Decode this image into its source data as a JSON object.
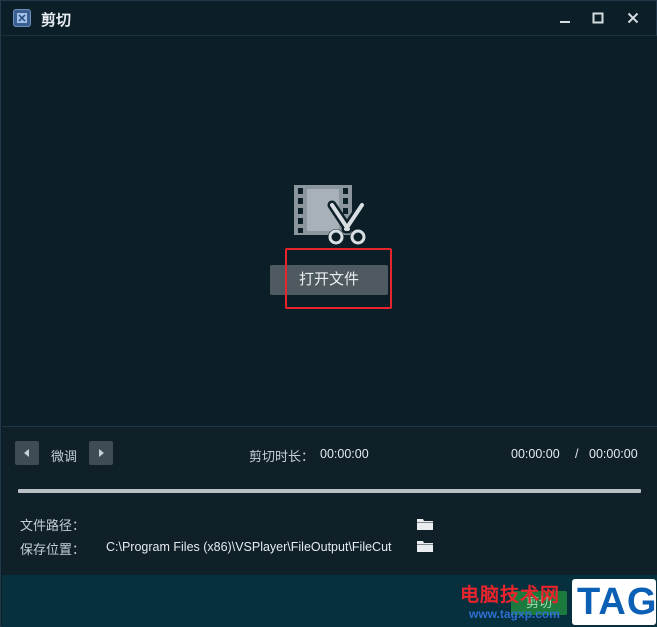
{
  "window": {
    "title": "剪切"
  },
  "titlebar": {
    "minimize": "minimize",
    "maximize": "maximize",
    "close": "close"
  },
  "stage": {
    "open_button_label": "打开文件"
  },
  "controls": {
    "fine_tune_label": "微调",
    "cut_duration_label": "剪切时长：",
    "cut_duration_value": "00:00:00",
    "current_time": "00:00:00",
    "time_separator": "/",
    "total_time": "00:00:00",
    "progress_fraction": 0
  },
  "paths": {
    "file_path_label": "文件路径：",
    "file_path_value": "",
    "save_location_label": "保存位置：",
    "save_location_value": "C:\\Program Files (x86)\\VSPlayer\\FileOutput\\FileCut"
  },
  "footer": {
    "cut_button_label": "剪切"
  },
  "watermark": {
    "site_name": "电脑技术网",
    "site_url": "www.tagxp.com",
    "tag_text": "TAG"
  },
  "colors": {
    "highlight_border": "#e8242c",
    "accent_green": "#1c7a3e",
    "background": "#0c1e27"
  },
  "icons": [
    "app-icon",
    "film-scissors-icon",
    "arrow-left-icon",
    "arrow-right-icon",
    "folder-icon",
    "minimize-icon",
    "maximize-icon",
    "close-icon"
  ]
}
